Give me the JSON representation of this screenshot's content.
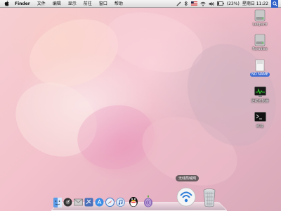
{
  "menubar": {
    "app_name": "Finder",
    "menus": [
      "文件",
      "编辑",
      "显示",
      "前往",
      "窗口",
      "帮助"
    ],
    "battery": "(23%)",
    "clock": "星期日 11:22"
  },
  "desktop_icons": [
    {
      "label": "Leopard",
      "type": "hard-drive",
      "selected": false
    },
    {
      "label": "Paradise",
      "type": "hard-drive",
      "selected": false
    },
    {
      "label": "NO NAME",
      "type": "removable-disk",
      "selected": true
    },
    {
      "label": "活动监视器",
      "type": "activity-monitor",
      "selected": false
    },
    {
      "label": "终端",
      "type": "terminal",
      "selected": false
    }
  ],
  "dock": {
    "tooltip": "无线局域网",
    "apps": [
      "finder",
      "dashboard",
      "mail",
      "system-tool",
      "app-store",
      "safari",
      "itunes",
      "qq",
      "tor-browser",
      "airport-utility",
      "trash"
    ]
  },
  "colors": {
    "selection": "#3d6bd1",
    "menubar": "#e8e8e8"
  }
}
